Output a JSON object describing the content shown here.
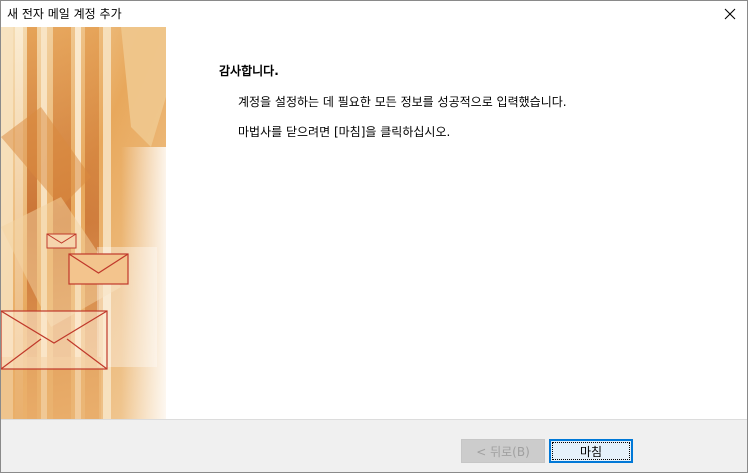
{
  "window": {
    "title": "새 전자 메일 계정 추가"
  },
  "content": {
    "heading": "감사합니다.",
    "line1": "계정을 설정하는 데 필요한 모든 정보를 성공적으로 입력했습니다.",
    "line2": "마법사를 닫으려면 [마침]을 클릭하십시오."
  },
  "footer": {
    "back_label": "< 뒤로(B)",
    "finish_label": "마침"
  },
  "colors": {
    "art_light": "#f3d9a8",
    "art_mid": "#e6a35a",
    "art_dark": "#c56a2a",
    "envelope_stroke": "#c0392b",
    "focus_border": "#0078d7"
  },
  "icons": {
    "close": "close-icon",
    "envelope": "envelope-icon"
  }
}
